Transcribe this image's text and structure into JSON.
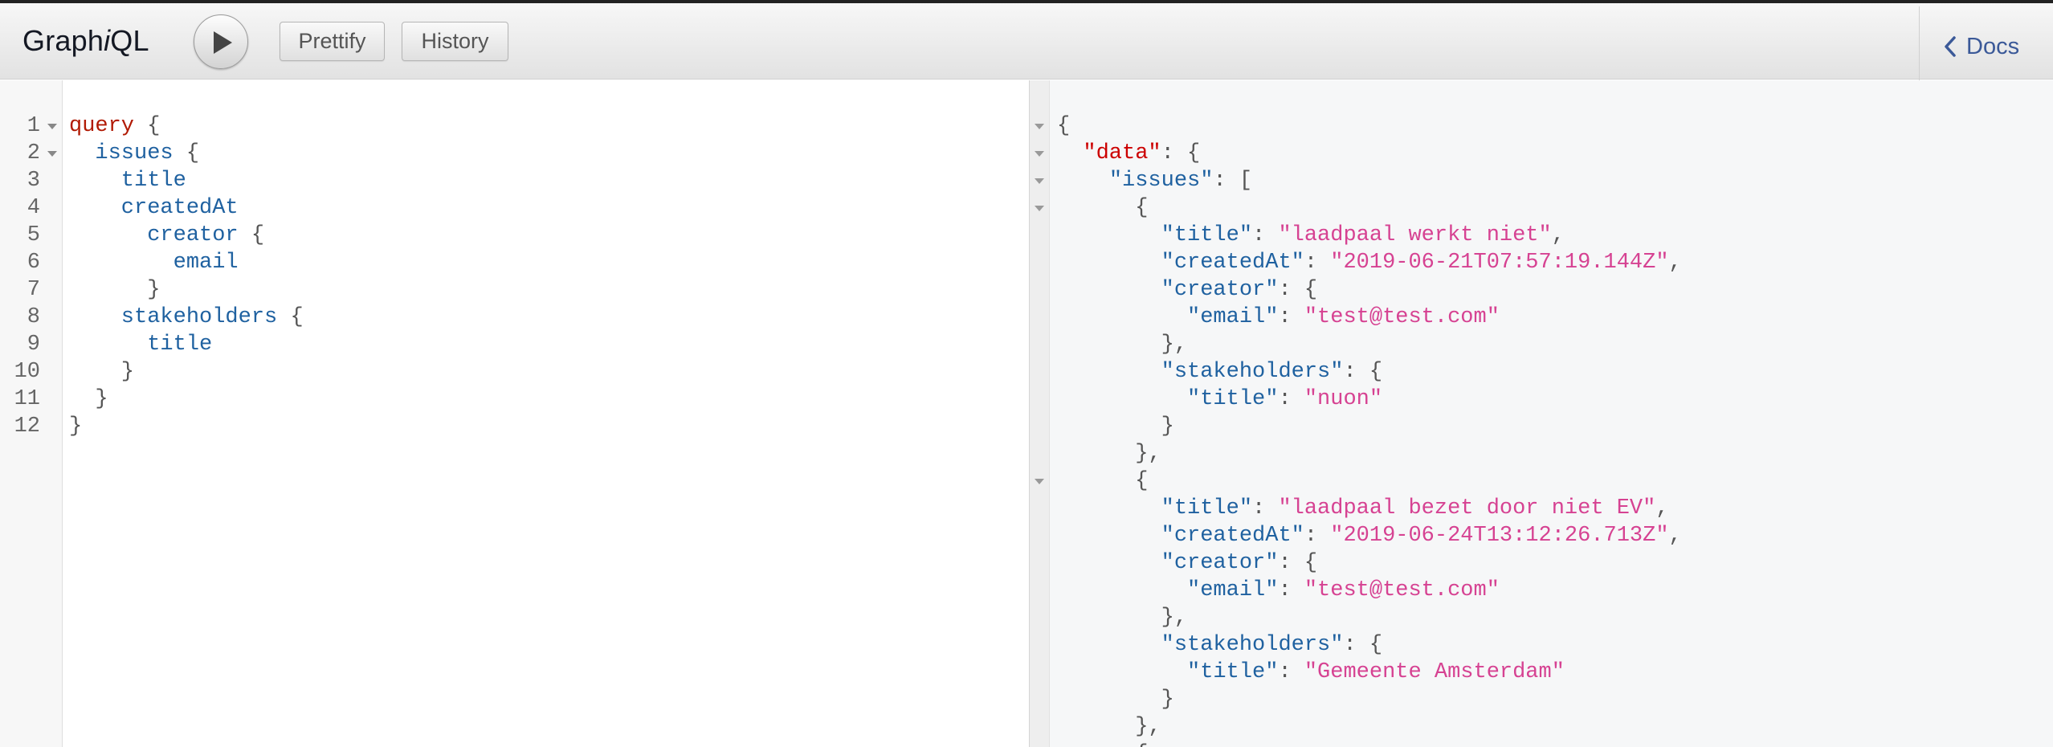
{
  "app": {
    "logo_prefix": "Graph",
    "logo_italic": "i",
    "logo_suffix": "QL"
  },
  "toolbar": {
    "run_label": "Execute Query",
    "prettify_label": "Prettify",
    "history_label": "History",
    "docs_label": "Docs"
  },
  "colors": {
    "keyword": "#b11a04",
    "field": "#1f61a0",
    "string": "#d64292",
    "docs_link": "#3b5998"
  },
  "query_editor": {
    "lines": [
      {
        "num": "1",
        "fold": true,
        "tokens": [
          {
            "t": "query",
            "c": "kw"
          },
          {
            "t": " {",
            "c": "pun"
          }
        ]
      },
      {
        "num": "2",
        "fold": true,
        "tokens": [
          {
            "t": "  issues",
            "c": "fld"
          },
          {
            "t": " {",
            "c": "pun"
          }
        ]
      },
      {
        "num": "3",
        "fold": false,
        "tokens": [
          {
            "t": "    title",
            "c": "fld"
          }
        ]
      },
      {
        "num": "4",
        "fold": false,
        "tokens": [
          {
            "t": "    createdAt",
            "c": "fld"
          }
        ]
      },
      {
        "num": "5",
        "fold": false,
        "tokens": [
          {
            "t": "      creator",
            "c": "fld"
          },
          {
            "t": " {",
            "c": "pun"
          }
        ]
      },
      {
        "num": "6",
        "fold": false,
        "tokens": [
          {
            "t": "        email",
            "c": "fld"
          }
        ]
      },
      {
        "num": "7",
        "fold": false,
        "tokens": [
          {
            "t": "      }",
            "c": "pun"
          }
        ]
      },
      {
        "num": "8",
        "fold": false,
        "tokens": [
          {
            "t": "    stakeholders",
            "c": "fld"
          },
          {
            "t": " {",
            "c": "pun"
          }
        ]
      },
      {
        "num": "9",
        "fold": false,
        "tokens": [
          {
            "t": "      title",
            "c": "fld"
          }
        ]
      },
      {
        "num": "10",
        "fold": false,
        "tokens": [
          {
            "t": "    }",
            "c": "pun"
          }
        ]
      },
      {
        "num": "11",
        "fold": false,
        "tokens": [
          {
            "t": "  }",
            "c": "pun"
          }
        ]
      },
      {
        "num": "12",
        "fold": false,
        "tokens": [
          {
            "t": "}",
            "c": "pun"
          }
        ]
      }
    ]
  },
  "result_viewer": {
    "lines": [
      {
        "fold": true,
        "tokens": [
          {
            "t": "{",
            "c": "pun"
          }
        ]
      },
      {
        "fold": true,
        "tokens": [
          {
            "t": "  ",
            "c": "pun"
          },
          {
            "t": "\"data\"",
            "c": "kq"
          },
          {
            "t": ": {",
            "c": "pun"
          }
        ]
      },
      {
        "fold": true,
        "tokens": [
          {
            "t": "    ",
            "c": "pun"
          },
          {
            "t": "\"issues\"",
            "c": "key"
          },
          {
            "t": ": [",
            "c": "pun"
          }
        ]
      },
      {
        "fold": true,
        "tokens": [
          {
            "t": "      {",
            "c": "pun"
          }
        ]
      },
      {
        "fold": false,
        "tokens": [
          {
            "t": "        ",
            "c": "pun"
          },
          {
            "t": "\"title\"",
            "c": "key"
          },
          {
            "t": ": ",
            "c": "pun"
          },
          {
            "t": "\"laadpaal werkt niet\"",
            "c": "str"
          },
          {
            "t": ",",
            "c": "pun"
          }
        ]
      },
      {
        "fold": false,
        "tokens": [
          {
            "t": "        ",
            "c": "pun"
          },
          {
            "t": "\"createdAt\"",
            "c": "key"
          },
          {
            "t": ": ",
            "c": "pun"
          },
          {
            "t": "\"2019-06-21T07:57:19.144Z\"",
            "c": "str"
          },
          {
            "t": ",",
            "c": "pun"
          }
        ]
      },
      {
        "fold": false,
        "tokens": [
          {
            "t": "        ",
            "c": "pun"
          },
          {
            "t": "\"creator\"",
            "c": "key"
          },
          {
            "t": ": {",
            "c": "pun"
          }
        ]
      },
      {
        "fold": false,
        "tokens": [
          {
            "t": "          ",
            "c": "pun"
          },
          {
            "t": "\"email\"",
            "c": "key"
          },
          {
            "t": ": ",
            "c": "pun"
          },
          {
            "t": "\"test@test.com\"",
            "c": "str"
          }
        ]
      },
      {
        "fold": false,
        "tokens": [
          {
            "t": "        },",
            "c": "pun"
          }
        ]
      },
      {
        "fold": false,
        "tokens": [
          {
            "t": "        ",
            "c": "pun"
          },
          {
            "t": "\"stakeholders\"",
            "c": "key"
          },
          {
            "t": ": {",
            "c": "pun"
          }
        ]
      },
      {
        "fold": false,
        "tokens": [
          {
            "t": "          ",
            "c": "pun"
          },
          {
            "t": "\"title\"",
            "c": "key"
          },
          {
            "t": ": ",
            "c": "pun"
          },
          {
            "t": "\"nuon\"",
            "c": "str"
          }
        ]
      },
      {
        "fold": false,
        "tokens": [
          {
            "t": "        }",
            "c": "pun"
          }
        ]
      },
      {
        "fold": false,
        "tokens": [
          {
            "t": "      },",
            "c": "pun"
          }
        ]
      },
      {
        "fold": true,
        "tokens": [
          {
            "t": "      {",
            "c": "pun"
          }
        ]
      },
      {
        "fold": false,
        "tokens": [
          {
            "t": "        ",
            "c": "pun"
          },
          {
            "t": "\"title\"",
            "c": "key"
          },
          {
            "t": ": ",
            "c": "pun"
          },
          {
            "t": "\"laadpaal bezet door niet EV\"",
            "c": "str"
          },
          {
            "t": ",",
            "c": "pun"
          }
        ]
      },
      {
        "fold": false,
        "tokens": [
          {
            "t": "        ",
            "c": "pun"
          },
          {
            "t": "\"createdAt\"",
            "c": "key"
          },
          {
            "t": ": ",
            "c": "pun"
          },
          {
            "t": "\"2019-06-24T13:12:26.713Z\"",
            "c": "str"
          },
          {
            "t": ",",
            "c": "pun"
          }
        ]
      },
      {
        "fold": false,
        "tokens": [
          {
            "t": "        ",
            "c": "pun"
          },
          {
            "t": "\"creator\"",
            "c": "key"
          },
          {
            "t": ": {",
            "c": "pun"
          }
        ]
      },
      {
        "fold": false,
        "tokens": [
          {
            "t": "          ",
            "c": "pun"
          },
          {
            "t": "\"email\"",
            "c": "key"
          },
          {
            "t": ": ",
            "c": "pun"
          },
          {
            "t": "\"test@test.com\"",
            "c": "str"
          }
        ]
      },
      {
        "fold": false,
        "tokens": [
          {
            "t": "        },",
            "c": "pun"
          }
        ]
      },
      {
        "fold": false,
        "tokens": [
          {
            "t": "        ",
            "c": "pun"
          },
          {
            "t": "\"stakeholders\"",
            "c": "key"
          },
          {
            "t": ": {",
            "c": "pun"
          }
        ]
      },
      {
        "fold": false,
        "tokens": [
          {
            "t": "          ",
            "c": "pun"
          },
          {
            "t": "\"title\"",
            "c": "key"
          },
          {
            "t": ": ",
            "c": "pun"
          },
          {
            "t": "\"Gemeente Amsterdam\"",
            "c": "str"
          }
        ]
      },
      {
        "fold": false,
        "tokens": [
          {
            "t": "        }",
            "c": "pun"
          }
        ]
      },
      {
        "fold": false,
        "tokens": [
          {
            "t": "      },",
            "c": "pun"
          }
        ]
      },
      {
        "fold": false,
        "tokens": [
          {
            "t": "      {",
            "c": "pun"
          }
        ]
      }
    ]
  }
}
